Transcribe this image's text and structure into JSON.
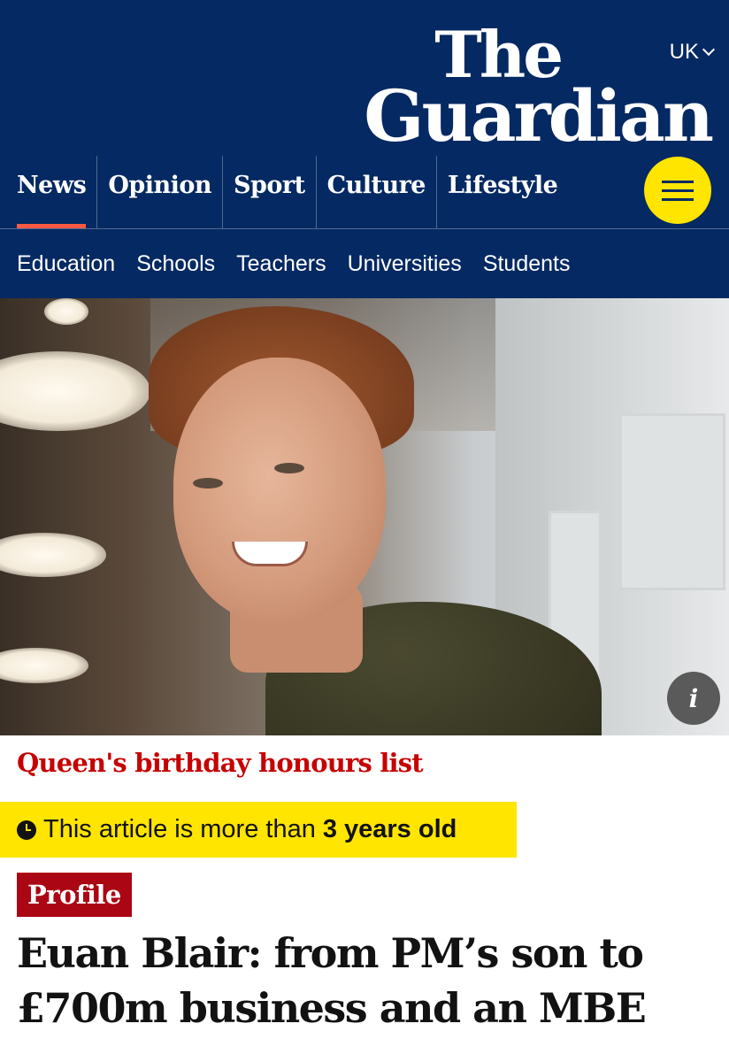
{
  "header": {
    "logo_line1": "The",
    "logo_line2": "Guardian",
    "edition": "UK",
    "background": "#052962",
    "pillars": [
      {
        "label": "News",
        "active": true
      },
      {
        "label": "Opinion",
        "active": false
      },
      {
        "label": "Sport",
        "active": false
      },
      {
        "label": "Culture",
        "active": false
      },
      {
        "label": "Lifestyle",
        "active": false
      }
    ],
    "menu_icon": "hamburger-icon",
    "subnav": [
      "Education",
      "Schools",
      "Teachers",
      "Universities",
      "Students"
    ]
  },
  "hero": {
    "info_icon": "info-icon",
    "info_label": "i"
  },
  "article": {
    "series": "Queen's birthday honours list",
    "age_notice_prefix": "This article is more than",
    "age_notice_value": "3 years old",
    "kicker": "Profile",
    "headline": "Euan Blair: from PM’s son to £700m business and an MBE"
  },
  "colors": {
    "brand_blue": "#052962",
    "news_accent": "#ff5943",
    "highlight_yellow": "#ffe500",
    "series_red": "#c70000",
    "kicker_red": "#ab0613"
  }
}
